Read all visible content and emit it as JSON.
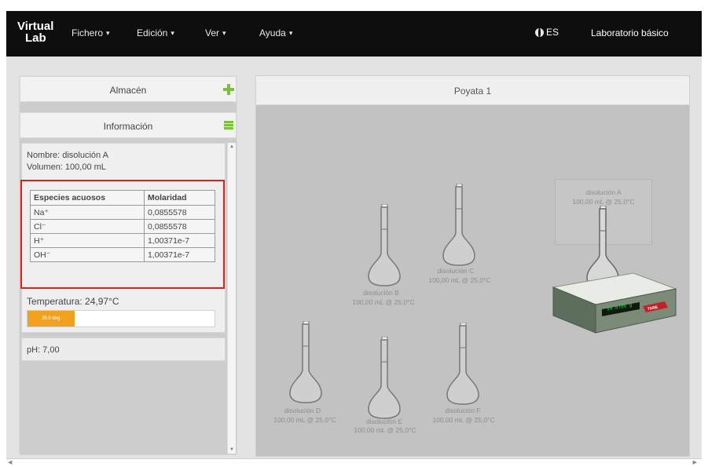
{
  "nav": {
    "brand_line1": "Virtual",
    "brand_line2": "Lab",
    "menus": [
      {
        "label": "Fichero",
        "caret": "▾"
      },
      {
        "label": "Edición",
        "caret": "▾"
      },
      {
        "label": "Ver",
        "caret": "▾"
      },
      {
        "label": "Ayuda",
        "caret": "▾"
      }
    ],
    "language": "ES",
    "lab_title": "Laboratorio básico"
  },
  "sidebar": {
    "almacen_label": "Almacén",
    "informacion_label": "Información",
    "nombre": "Nombre: disolución A",
    "volumen": "Volumen: 100,00 mL",
    "table_headers": [
      "Especies acuosos",
      "Molaridad"
    ],
    "table_rows": [
      {
        "species": "Na⁺",
        "molarity": "0,0855578"
      },
      {
        "species": "Cl⁻",
        "molarity": "0,0855578"
      },
      {
        "species": "H⁺",
        "molarity": "1,00371e-7"
      },
      {
        "species": "OH⁻",
        "molarity": "1,00371e-7"
      }
    ],
    "temperature": "Temperatura: 24,97°C",
    "temperature_fraction": 0.25,
    "temp_bar_label": "25.0 deg",
    "ph": "pH: 7,00"
  },
  "bench": {
    "title": "Poyata 1",
    "flasks": [
      {
        "name": "disolución A",
        "detail": "100,00 mL @ 25,0°C"
      },
      {
        "name": "disolución B",
        "detail": "100,00 mL @ 25,0°C"
      },
      {
        "name": "disolución C",
        "detail": "100,00 mL @ 25,0°C"
      },
      {
        "name": "disolución D",
        "detail": "100,00 mL @ 25,0°C"
      },
      {
        "name": "disolución E",
        "detail": "100,00 mL @ 25,0°C"
      },
      {
        "name": "disolución F",
        "detail": "100,00 mL @ 25,0°C"
      }
    ],
    "scale_display": "99.8786 g",
    "scale_button": "TARE"
  },
  "colors": {
    "navbar": "#0e0e0e",
    "accent_green": "#7bbf3a",
    "temp_orange": "#f0a21e",
    "highlight_red": "#e0201b",
    "scale_button_red": "#c0222a",
    "scale_display_green": "#2fd14a"
  },
  "icons": [
    "globe-icon",
    "plus-icon",
    "list-icon",
    "chevron-down-icon",
    "volumetric-flask-icon",
    "scale-icon"
  ]
}
